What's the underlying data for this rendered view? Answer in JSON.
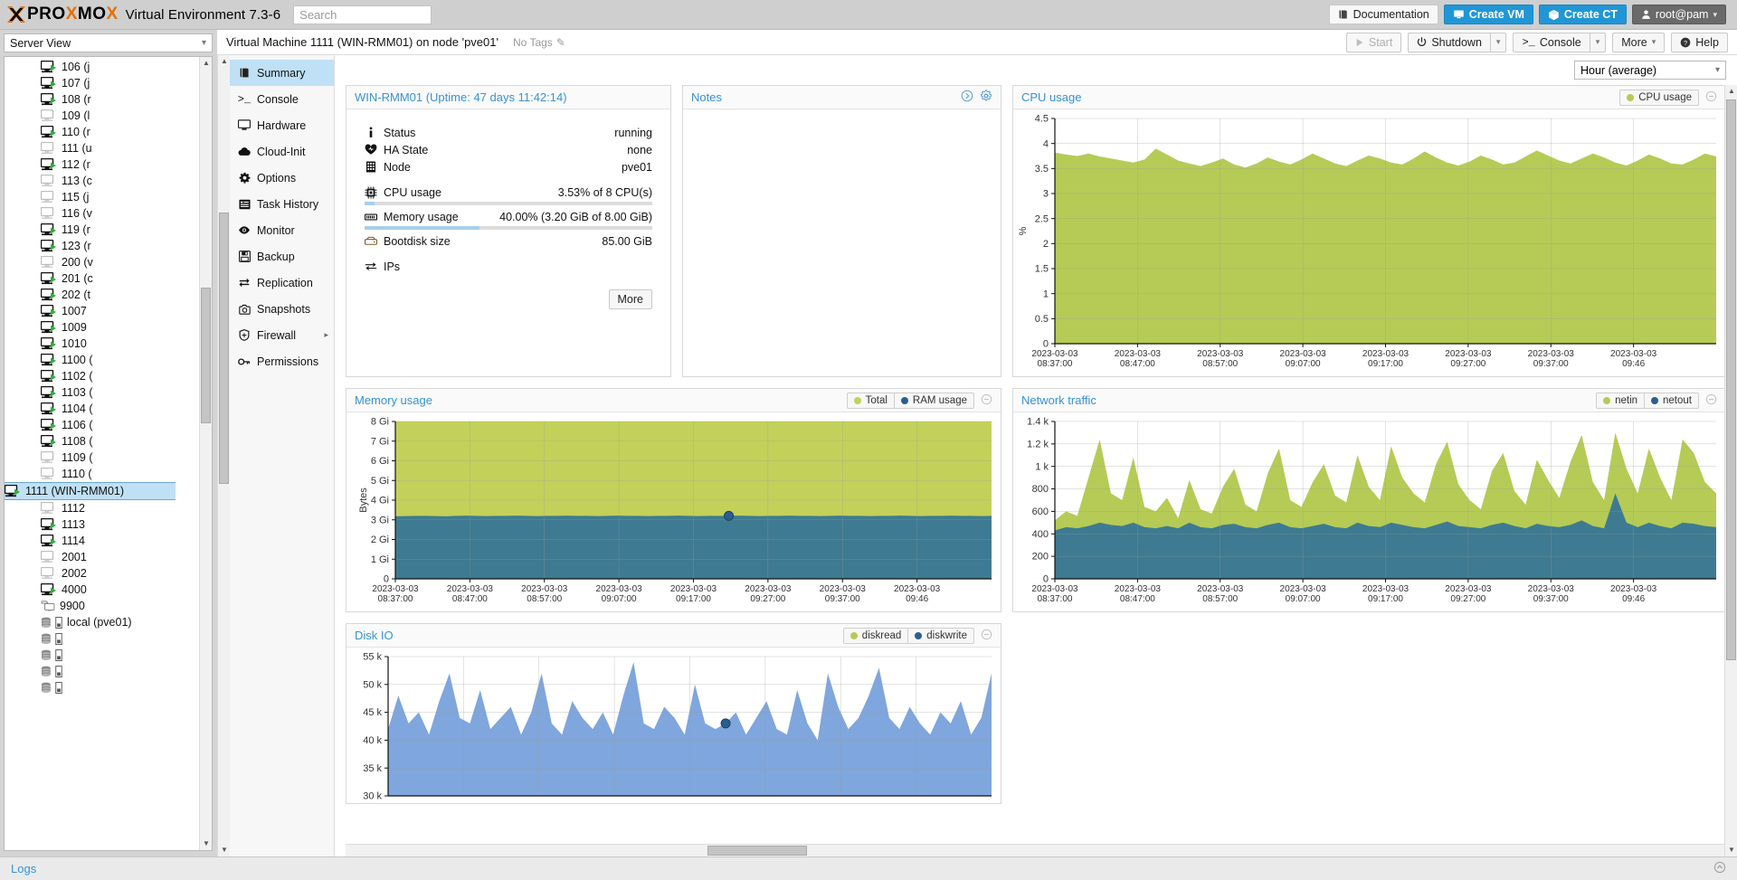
{
  "header": {
    "brand": "PROXMOX",
    "product": "Virtual Environment 7.3-6",
    "search_placeholder": "Search",
    "search_value": "",
    "documentation_label": "Documentation",
    "create_vm_label": "Create VM",
    "create_ct_label": "Create CT",
    "user_label": "root@pam"
  },
  "sidebar": {
    "view_label": "Server View",
    "items": [
      {
        "label": "106 (j",
        "type": "qemu",
        "running": true
      },
      {
        "label": "107 (j",
        "type": "qemu",
        "running": true
      },
      {
        "label": "108 (r",
        "type": "qemu",
        "running": true
      },
      {
        "label": "109 (l",
        "type": "qemu",
        "running": false
      },
      {
        "label": "110 (r",
        "type": "qemu",
        "running": true
      },
      {
        "label": "111 (u",
        "type": "qemu",
        "running": false
      },
      {
        "label": "112 (r",
        "type": "qemu",
        "running": true
      },
      {
        "label": "113 (c",
        "type": "qemu",
        "running": false
      },
      {
        "label": "115 (j",
        "type": "qemu",
        "running": false
      },
      {
        "label": "116 (v",
        "type": "qemu",
        "running": false
      },
      {
        "label": "119 (r",
        "type": "qemu",
        "running": true
      },
      {
        "label": "123 (r",
        "type": "qemu",
        "running": true
      },
      {
        "label": "200 (v",
        "type": "qemu",
        "running": false
      },
      {
        "label": "201 (c",
        "type": "qemu",
        "running": true
      },
      {
        "label": "202 (t",
        "type": "qemu",
        "running": true
      },
      {
        "label": "1007",
        "type": "qemu",
        "running": true
      },
      {
        "label": "1009",
        "type": "qemu",
        "running": true
      },
      {
        "label": "1010",
        "type": "qemu",
        "running": true
      },
      {
        "label": "1100 (",
        "type": "qemu",
        "running": true
      },
      {
        "label": "1102 (",
        "type": "qemu",
        "running": true
      },
      {
        "label": "1103 (",
        "type": "qemu",
        "running": true
      },
      {
        "label": "1104 (",
        "type": "qemu",
        "running": true
      },
      {
        "label": "1106 (",
        "type": "qemu",
        "running": true
      },
      {
        "label": "1108 (",
        "type": "qemu",
        "running": true
      },
      {
        "label": "1109 (",
        "type": "qemu",
        "running": false
      },
      {
        "label": "1110 (",
        "type": "qemu",
        "running": false
      },
      {
        "label": "1111 (WIN-RMM01)",
        "type": "qemu",
        "running": true,
        "selected": true
      },
      {
        "label": "1112",
        "type": "qemu",
        "running": false
      },
      {
        "label": "1113",
        "type": "qemu",
        "running": true
      },
      {
        "label": "1114",
        "type": "qemu",
        "running": true
      },
      {
        "label": "2001",
        "type": "qemu",
        "running": false
      },
      {
        "label": "2002",
        "type": "qemu",
        "running": false
      },
      {
        "label": "4000",
        "type": "qemu",
        "running": true
      },
      {
        "label": "9900",
        "type": "template",
        "running": false
      },
      {
        "label": "local (pve01)",
        "type": "storage",
        "running": false
      },
      {
        "label": "",
        "type": "storage",
        "running": false
      },
      {
        "label": "",
        "type": "storage",
        "running": false
      },
      {
        "label": "",
        "type": "storage",
        "running": false
      },
      {
        "label": "",
        "type": "storage",
        "running": false
      }
    ]
  },
  "breadcrumb": {
    "title": "Virtual Machine 1111 (WIN-RMM01) on node 'pve01'",
    "tags_label": "No Tags",
    "actions": {
      "start": "Start",
      "shutdown": "Shutdown",
      "console": "Console",
      "more": "More",
      "help": "Help"
    }
  },
  "nav": {
    "items": [
      {
        "label": "Summary",
        "icon": "book-icon",
        "active": true,
        "submenu": false
      },
      {
        "label": "Console",
        "icon": "terminal-icon",
        "active": false,
        "submenu": false
      },
      {
        "label": "Hardware",
        "icon": "monitor-icon",
        "active": false,
        "submenu": false
      },
      {
        "label": "Cloud-Init",
        "icon": "cloud-icon",
        "active": false,
        "submenu": false
      },
      {
        "label": "Options",
        "icon": "gear-icon",
        "active": false,
        "submenu": false
      },
      {
        "label": "Task History",
        "icon": "list-icon",
        "active": false,
        "submenu": false
      },
      {
        "label": "Monitor",
        "icon": "eye-icon",
        "active": false,
        "submenu": false
      },
      {
        "label": "Backup",
        "icon": "floppy-icon",
        "active": false,
        "submenu": false
      },
      {
        "label": "Replication",
        "icon": "replication-icon",
        "active": false,
        "submenu": false
      },
      {
        "label": "Snapshots",
        "icon": "camera-icon",
        "active": false,
        "submenu": false
      },
      {
        "label": "Firewall",
        "icon": "shield-icon",
        "active": false,
        "submenu": true
      },
      {
        "label": "Permissions",
        "icon": "key-icon",
        "active": false,
        "submenu": false
      }
    ]
  },
  "dashboard": {
    "timerange_value": "Hour (average)",
    "status_panel": {
      "title": "WIN-RMM01 (Uptime: 47 days 11:42:14)",
      "rows": [
        {
          "icon": "info-icon",
          "label": "Status",
          "value": "running",
          "bar": null
        },
        {
          "icon": "heart-icon",
          "label": "HA State",
          "value": "none",
          "bar": null
        },
        {
          "icon": "node-icon",
          "label": "Node",
          "value": "pve01",
          "bar": null
        },
        {
          "icon": "cpu-icon",
          "label": "CPU usage",
          "value": "3.53% of 8 CPU(s)",
          "bar": 3.53
        },
        {
          "icon": "memory-icon",
          "label": "Memory usage",
          "value": "40.00% (3.20 GiB of 8.00 GiB)",
          "bar": 40.0
        },
        {
          "icon": "disk-icon",
          "label": "Bootdisk size",
          "value": "85.00 GiB",
          "bar": null
        },
        {
          "icon": "ips-icon",
          "label": "IPs",
          "value": "",
          "bar": null
        }
      ],
      "more_label": "More"
    },
    "notes_panel": {
      "title": "Notes",
      "content": ""
    },
    "charts": [
      {
        "id": "cpu-usage",
        "title": "CPU usage",
        "legend": [
          {
            "label": "CPU usage",
            "color": "#b5cb56"
          }
        ]
      },
      {
        "id": "memory-usage",
        "title": "Memory usage",
        "legend": [
          {
            "label": "Total",
            "color": "#c3d15a"
          },
          {
            "label": "RAM usage",
            "color": "#2f5e8c"
          }
        ]
      },
      {
        "id": "network-traffic",
        "title": "Network traffic",
        "legend": [
          {
            "label": "netin",
            "color": "#b5cb56"
          },
          {
            "label": "netout",
            "color": "#2f5e8c"
          }
        ]
      },
      {
        "id": "disk-io",
        "title": "Disk IO",
        "legend": [
          {
            "label": "diskread",
            "color": "#b5cb56"
          },
          {
            "label": "diskwrite",
            "color": "#2f5e8c"
          }
        ]
      }
    ]
  },
  "footer": {
    "logs_label": "Logs"
  },
  "chart_data": [
    {
      "id": "cpu-usage",
      "type": "area",
      "title": "CPU usage",
      "ylabel": "%",
      "xlabel": "",
      "ylim": [
        0,
        4.5
      ],
      "yticks": [
        0,
        0.5,
        1,
        1.5,
        2,
        2.5,
        3,
        3.5,
        4,
        4.5
      ],
      "ytick_labels": [
        "0",
        "0.5",
        "1",
        "1.5",
        "2",
        "2.5",
        "3",
        "3.5",
        "4",
        "4.5"
      ],
      "xtick_labels": [
        "2023-03-03 08:37:00",
        "2023-03-03 08:47:00",
        "2023-03-03 08:57:00",
        "2023-03-03 09:07:00",
        "2023-03-03 09:17:00",
        "2023-03-03 09:27:00",
        "2023-03-03 09:37:00",
        "2023-03-03 09:46"
      ],
      "grid": true,
      "legend_position": "top-right",
      "series": [
        {
          "name": "CPU usage",
          "color": "#b5cb56",
          "values": [
            3.82,
            3.78,
            3.75,
            3.8,
            3.74,
            3.7,
            3.66,
            3.62,
            3.68,
            3.9,
            3.78,
            3.66,
            3.6,
            3.55,
            3.62,
            3.7,
            3.58,
            3.52,
            3.6,
            3.72,
            3.64,
            3.58,
            3.68,
            3.8,
            3.7,
            3.6,
            3.55,
            3.66,
            3.76,
            3.7,
            3.62,
            3.58,
            3.7,
            3.84,
            3.72,
            3.62,
            3.56,
            3.64,
            3.76,
            3.68,
            3.58,
            3.62,
            3.74,
            3.86,
            3.76,
            3.66,
            3.6,
            3.7,
            3.8,
            3.72,
            3.62,
            3.56,
            3.66,
            3.78,
            3.7,
            3.6,
            3.58,
            3.68,
            3.8,
            3.74
          ]
        }
      ]
    },
    {
      "id": "memory-usage",
      "type": "area",
      "title": "Memory usage",
      "ylabel": "Bytes",
      "xlabel": "",
      "ylim": [
        0,
        8
      ],
      "yticks": [
        0,
        1,
        2,
        3,
        4,
        5,
        6,
        7,
        8
      ],
      "ytick_labels": [
        "0",
        "1 Gi",
        "2 Gi",
        "3 Gi",
        "4 Gi",
        "5 Gi",
        "6 Gi",
        "7 Gi",
        "8 Gi"
      ],
      "xtick_labels": [
        "2023-03-03 08:37:00",
        "2023-03-03 08:47:00",
        "2023-03-03 08:57:00",
        "2023-03-03 09:07:00",
        "2023-03-03 09:17:00",
        "2023-03-03 09:27:00",
        "2023-03-03 09:37:00",
        "2023-03-03 09:46"
      ],
      "grid": true,
      "legend_position": "top-right",
      "marker": {
        "x_index": 33,
        "y": 3.2
      },
      "series": [
        {
          "name": "Total",
          "color": "#c3d15a",
          "values": [
            8,
            8,
            8,
            8,
            8,
            8,
            8,
            8,
            8,
            8,
            8,
            8,
            8,
            8,
            8,
            8,
            8,
            8,
            8,
            8,
            8,
            8,
            8,
            8,
            8,
            8,
            8,
            8,
            8,
            8,
            8,
            8,
            8,
            8,
            8,
            8,
            8,
            8,
            8,
            8,
            8,
            8,
            8,
            8,
            8,
            8,
            8,
            8,
            8,
            8,
            8,
            8,
            8,
            8,
            8,
            8,
            8,
            8,
            8,
            8
          ]
        },
        {
          "name": "RAM usage",
          "color": "#3e7a91",
          "values": [
            3.18,
            3.19,
            3.2,
            3.2,
            3.19,
            3.18,
            3.2,
            3.21,
            3.2,
            3.19,
            3.2,
            3.2,
            3.21,
            3.2,
            3.19,
            3.2,
            3.2,
            3.21,
            3.2,
            3.2,
            3.19,
            3.2,
            3.21,
            3.2,
            3.2,
            3.19,
            3.2,
            3.2,
            3.21,
            3.2,
            3.19,
            3.2,
            3.2,
            3.2,
            3.21,
            3.2,
            3.19,
            3.2,
            3.2,
            3.21,
            3.2,
            3.2,
            3.19,
            3.2,
            3.21,
            3.2,
            3.2,
            3.19,
            3.2,
            3.2,
            3.21,
            3.2,
            3.19,
            3.2,
            3.2,
            3.21,
            3.2,
            3.2,
            3.19,
            3.2
          ]
        }
      ]
    },
    {
      "id": "network-traffic",
      "type": "area",
      "title": "Network traffic",
      "ylabel": "",
      "xlabel": "",
      "ylim": [
        0,
        1400
      ],
      "yticks": [
        0,
        200,
        400,
        600,
        800,
        1000,
        1200,
        1400
      ],
      "ytick_labels": [
        "0",
        "200",
        "400",
        "600",
        "800",
        "1 k",
        "1.2 k",
        "1.4 k"
      ],
      "xtick_labels": [
        "2023-03-03 08:37:00",
        "2023-03-03 08:47:00",
        "2023-03-03 08:57:00",
        "2023-03-03 09:07:00",
        "2023-03-03 09:17:00",
        "2023-03-03 09:27:00",
        "2023-03-03 09:37:00",
        "2023-03-03 09:46"
      ],
      "grid": true,
      "legend_position": "top-right",
      "series": [
        {
          "name": "netin",
          "color": "#b5cb56",
          "values": [
            520,
            600,
            560,
            900,
            1240,
            760,
            700,
            1080,
            640,
            600,
            720,
            540,
            880,
            620,
            580,
            820,
            980,
            660,
            600,
            940,
            1160,
            700,
            640,
            860,
            1020,
            740,
            680,
            1100,
            820,
            700,
            1180,
            900,
            760,
            680,
            1020,
            1220,
            840,
            700,
            620,
            960,
            1120,
            780,
            660,
            1060,
            880,
            720,
            1040,
            1280,
            860,
            700,
            1300,
            980,
            760,
            1160,
            900,
            700,
            1240,
            1120,
            860,
            760
          ]
        },
        {
          "name": "netout",
          "color": "#3e7a91",
          "values": [
            430,
            460,
            450,
            470,
            500,
            480,
            470,
            500,
            460,
            450,
            470,
            450,
            500,
            460,
            450,
            480,
            490,
            460,
            450,
            480,
            500,
            460,
            450,
            470,
            490,
            460,
            450,
            500,
            470,
            460,
            500,
            480,
            460,
            450,
            480,
            510,
            470,
            460,
            450,
            480,
            500,
            470,
            450,
            490,
            470,
            460,
            480,
            520,
            470,
            450,
            760,
            500,
            460,
            500,
            470,
            450,
            500,
            490,
            470,
            460
          ]
        }
      ]
    },
    {
      "id": "disk-io",
      "type": "area",
      "title": "Disk IO",
      "ylabel": "",
      "xlabel": "",
      "ylim": [
        30000,
        55000
      ],
      "yticks": [
        30000,
        35000,
        40000,
        45000,
        50000,
        55000
      ],
      "ytick_labels": [
        "30 k",
        "35 k",
        "40 k",
        "45 k",
        "50 k",
        "55 k"
      ],
      "xtick_labels": [],
      "grid": true,
      "legend_position": "top-right",
      "marker": {
        "x_index": 33,
        "y": 43000
      },
      "series": [
        {
          "name": "diskread",
          "color": "#b5cb56",
          "values": [
            0,
            0,
            0,
            0,
            0,
            0,
            0,
            0,
            0,
            0,
            0,
            0,
            0,
            0,
            0,
            0,
            0,
            0,
            0,
            0,
            0,
            0,
            0,
            0,
            0,
            0,
            0,
            0,
            0,
            0,
            0,
            0,
            0,
            0,
            0,
            0,
            0,
            0,
            0,
            0,
            0,
            0,
            0,
            0,
            0,
            0,
            0,
            0,
            0,
            0,
            0,
            0,
            0,
            0,
            0,
            0,
            0,
            0,
            0,
            0
          ]
        },
        {
          "name": "diskwrite",
          "color": "#7fa6dd",
          "values": [
            42000,
            48000,
            43000,
            45000,
            41000,
            47000,
            52000,
            44000,
            43000,
            49000,
            42000,
            44000,
            46000,
            41000,
            45000,
            52000,
            43000,
            41000,
            47000,
            44000,
            42000,
            45000,
            41000,
            48000,
            54000,
            43000,
            42000,
            46000,
            44000,
            41000,
            50000,
            43000,
            42000,
            43000,
            45000,
            41000,
            44000,
            47000,
            42000,
            41000,
            49000,
            43000,
            40000,
            52000,
            46000,
            42000,
            44000,
            48000,
            53000,
            44000,
            42000,
            46000,
            43000,
            41000,
            45000,
            43000,
            47000,
            41000,
            44000,
            52000
          ]
        }
      ]
    }
  ]
}
